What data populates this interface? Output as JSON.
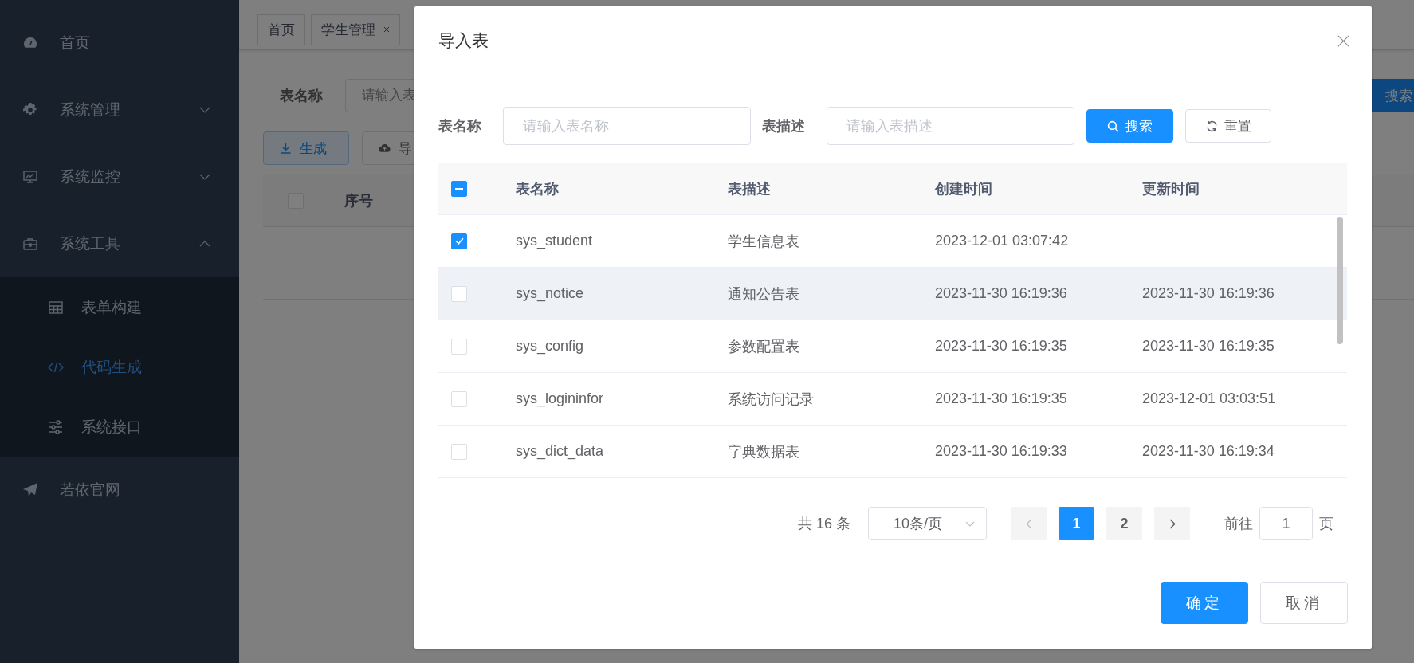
{
  "sidebar": {
    "items": [
      {
        "label": "首页"
      },
      {
        "label": "系统管理",
        "expanded": false
      },
      {
        "label": "系统监控",
        "expanded": false
      },
      {
        "label": "系统工具",
        "expanded": true,
        "children": [
          {
            "label": "表单构建",
            "selected": false
          },
          {
            "label": "代码生成",
            "selected": true
          },
          {
            "label": "系统接口",
            "selected": false
          }
        ]
      },
      {
        "label": "若依官网"
      }
    ]
  },
  "tags": [
    {
      "label": "首页",
      "closable": false
    },
    {
      "label": "学生管理",
      "closable": true
    }
  ],
  "page": {
    "search": {
      "label": "表名称",
      "placeholder": "请输入表",
      "button": "搜索"
    },
    "toolbar": [
      "生成",
      "导"
    ],
    "table": {
      "header_checkbox": {
        "checked": false
      },
      "columns": [
        "序号"
      ]
    }
  },
  "dialog": {
    "title": "导入表",
    "filters": [
      {
        "label": "表名称",
        "placeholder": "请输入表名称"
      },
      {
        "label": "表描述",
        "placeholder": "请输入表描述"
      }
    ],
    "search_button": "搜索",
    "reset_button": "重置",
    "table": {
      "header_checkbox": {
        "indeterminate": true
      },
      "columns": [
        "表名称",
        "表描述",
        "创建时间",
        "更新时间"
      ],
      "rows": [
        {
          "checked": true,
          "hovered": false,
          "name": "sys_student",
          "description": "学生信息表",
          "created": "2023-12-01 03:07:42"
        },
        {
          "checked": false,
          "hovered": true,
          "name": "sys_notice",
          "description": "通知公告表",
          "created": "2023-11-30 16:19:36",
          "updated": "2023-11-30 16:19:36"
        },
        {
          "checked": false,
          "hovered": false,
          "name": "sys_config",
          "description": "参数配置表",
          "created": "2023-11-30 16:19:35",
          "updated": "2023-11-30 16:19:35"
        },
        {
          "checked": false,
          "hovered": false,
          "name": "sys_logininfor",
          "description": "系统访问记录",
          "created": "2023-11-30 16:19:35",
          "updated": "2023-12-01 03:03:51"
        },
        {
          "checked": false,
          "hovered": false,
          "name": "sys_dict_data",
          "description": "字典数据表",
          "created": "2023-11-30 16:19:33",
          "updated": "2023-11-30 16:19:34"
        }
      ]
    },
    "pagination": {
      "total": "共 16 条",
      "page_size": "10条/页",
      "prev_disabled": true,
      "next_disabled": false,
      "pages": [
        {
          "label": "1",
          "selected": true
        },
        {
          "label": "2",
          "selected": false
        }
      ],
      "goto_label": "前往",
      "goto_value": "1",
      "goto_suffix": "页"
    },
    "confirm": "确定",
    "cancel": "取消"
  }
}
